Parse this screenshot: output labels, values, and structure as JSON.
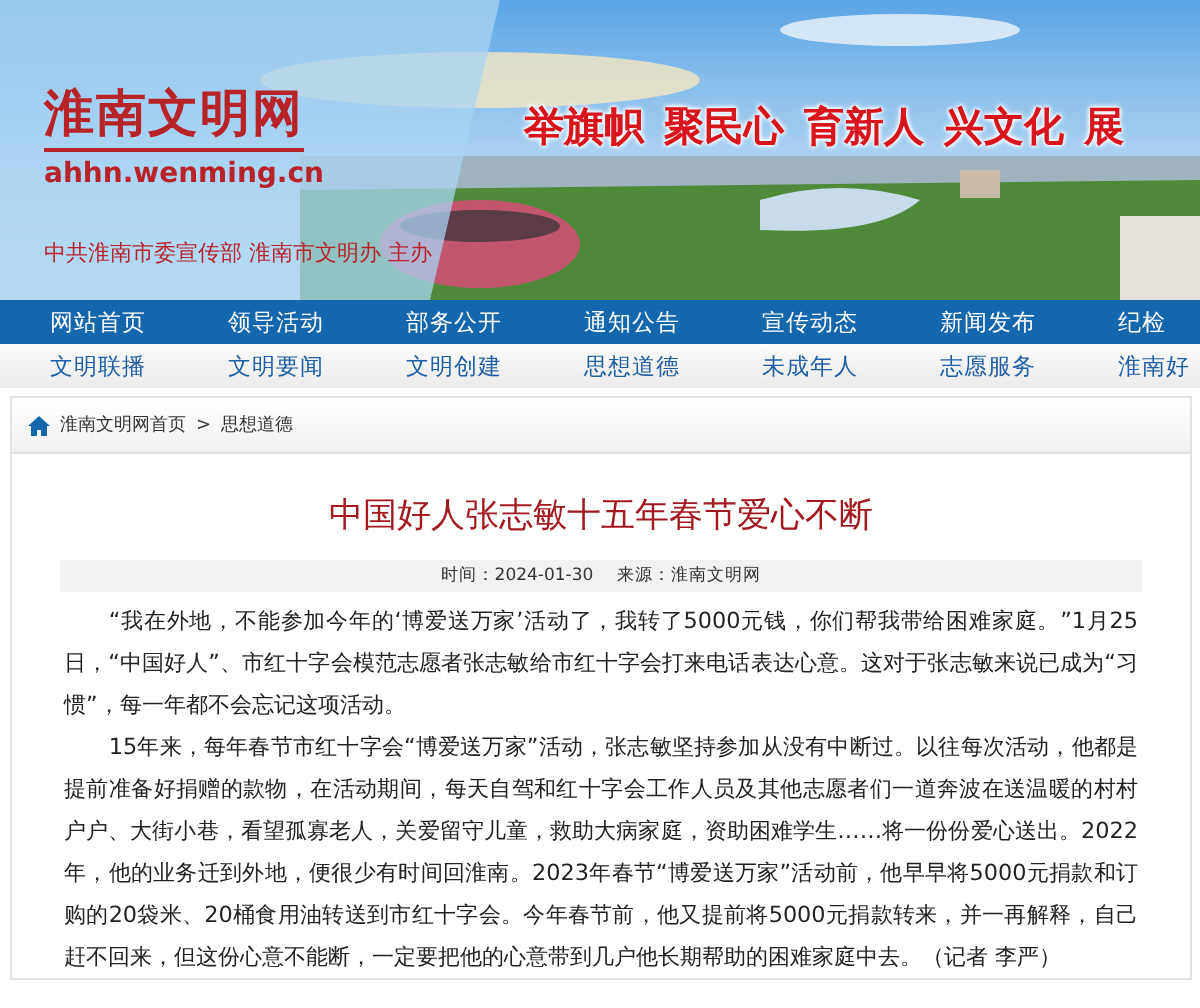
{
  "header": {
    "site_name": "淮南文明网",
    "domain": "ahhn.wenming.cn",
    "sponsor": "中共淮南市委宣传部 淮南市文明办 主办",
    "slogan": [
      "举旗帜",
      "聚民心",
      "育新人",
      "兴文化",
      "展"
    ]
  },
  "main_nav": [
    {
      "label": "网站首页"
    },
    {
      "label": "领导活动"
    },
    {
      "label": "部务公开"
    },
    {
      "label": "通知公告"
    },
    {
      "label": "宣传动态"
    },
    {
      "label": "新闻发布"
    },
    {
      "label": "纪检"
    }
  ],
  "sub_nav": [
    {
      "label": "文明联播"
    },
    {
      "label": "文明要闻"
    },
    {
      "label": "文明创建"
    },
    {
      "label": "思想道德"
    },
    {
      "label": "未成年人"
    },
    {
      "label": "志愿服务"
    },
    {
      "label": "淮南好"
    }
  ],
  "breadcrumb": {
    "items": [
      "淮南文明网首页",
      "思想道德"
    ],
    "separator": ">"
  },
  "article": {
    "title": "中国好人张志敏十五年春节爱心不断",
    "time": "时间：2024-01-30",
    "source": "来源：淮南文明网",
    "paragraphs": [
      "“我在外地，不能参加今年的‘博爱送万家’活动了，我转了5000元钱，你们帮我带给困难家庭。”1月25日，“中国好人”、市红十字会模范志愿者张志敏给市红十字会打来电话表达心意。这对于张志敏来说已成为“习惯”，每一年都不会忘记这项活动。",
      "15年来，每年春节市红十字会“博爱送万家”活动，张志敏坚持参加从没有中断过。以往每次活动，他都是提前准备好捐赠的款物，在活动期间，每天自驾和红十字会工作人员及其他志愿者们一道奔波在送温暖的村村户户、大街小巷，看望孤寡老人，关爱留守儿童，救助大病家庭，资助困难学生……将一份份爱心送出。2022年，他的业务迁到外地，便很少有时间回淮南。2023年春节“博爱送万家”活动前，他早早将5000元捐款和订购的20袋米、20桶食用油转送到市红十字会。今年春节前，他又提前将5000元捐款转来，并一再解释，自己赶不回来，但这份心意不能断，一定要把他的心意带到几户他长期帮助的困难家庭中去。（记者 李严）"
    ]
  }
}
